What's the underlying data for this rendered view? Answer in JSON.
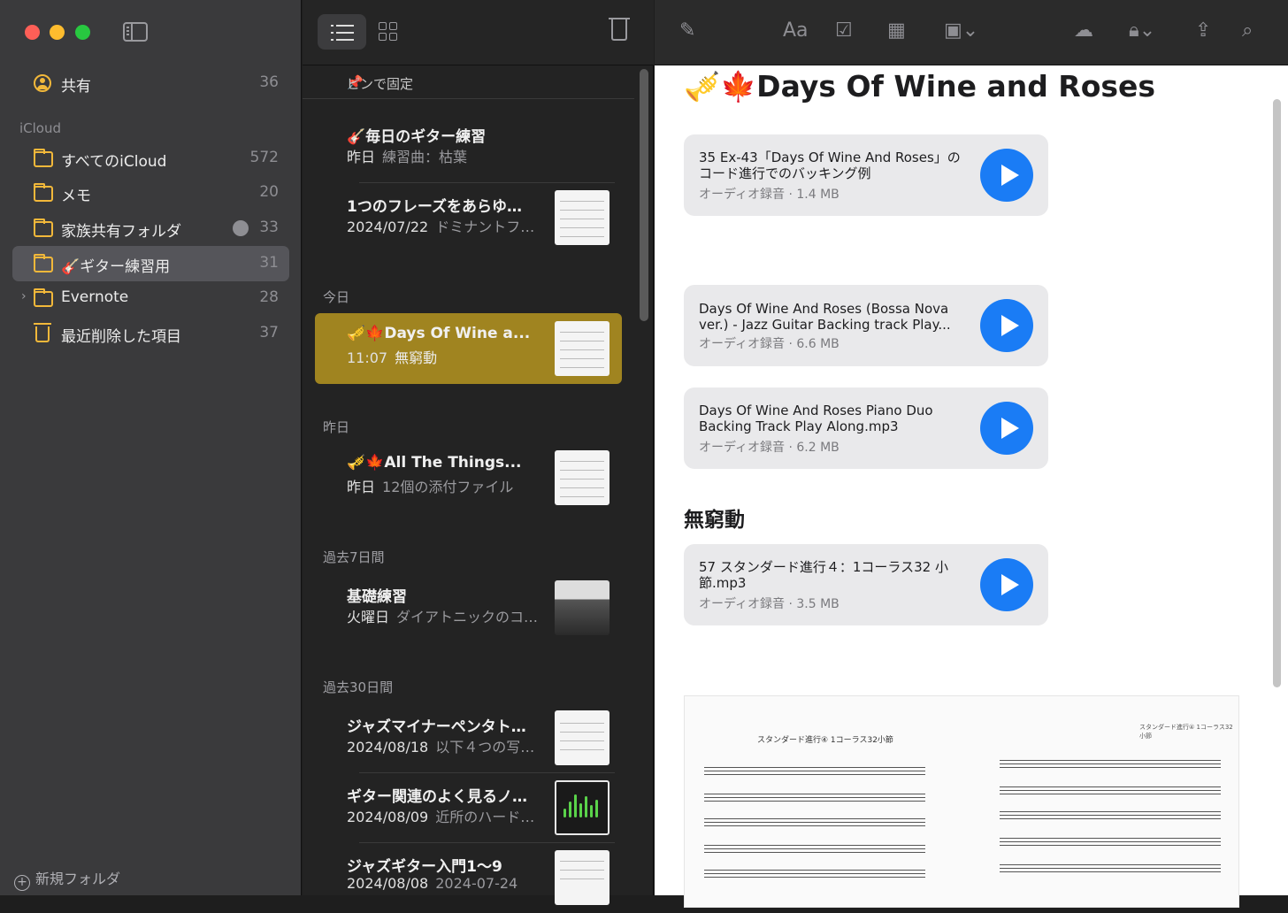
{
  "colors": {
    "accent": "#f2b83a",
    "selected_note": "#a08420",
    "play_button": "#1a7cf5",
    "red": "#fe5f57",
    "yellow": "#febc2e",
    "green": "#28c840"
  },
  "sidebar": {
    "shared": {
      "label": "共有",
      "count": "36"
    },
    "section": "iCloud",
    "folders": [
      {
        "label": "すべてのiCloud",
        "count": "572",
        "icon": "folder-icon"
      },
      {
        "label": "メモ",
        "count": "20",
        "icon": "folder-icon"
      },
      {
        "label": "家族共有フォルダ",
        "count": "33",
        "icon": "shared-folder-icon"
      },
      {
        "label": "🎸ギター練習用",
        "count": "31",
        "icon": "folder-icon"
      },
      {
        "label": "Evernote",
        "count": "28",
        "icon": "folder-icon"
      },
      {
        "label": "最近削除した項目",
        "count": "37",
        "icon": "trash-icon"
      }
    ],
    "new_folder": "新規フォルダ"
  },
  "list": {
    "pinned_header": "ピンで固定",
    "sections": {
      "today": "今日",
      "yesterday": "昨日",
      "last7": "過去7日間",
      "last30": "過去30日間"
    },
    "notes": [
      {
        "title": "🎸毎日のギター練習",
        "date": "昨日",
        "preview": "練習曲：枯葉"
      },
      {
        "title": "1つのフレーズをあらゆ…",
        "date": "2024/07/22",
        "preview": "ドミナントフ…"
      },
      {
        "title": "🎺🍁Days Of Wine a...",
        "date": "11:07",
        "preview": "無窮動"
      },
      {
        "title": "🎺🍁All The Things...",
        "date": "昨日",
        "preview": "12個の添付ファイル"
      },
      {
        "title": "基礎練習",
        "date": "火曜日",
        "preview": "ダイアトニックのコ…"
      },
      {
        "title": "ジャズマイナーペンタト…",
        "date": "2024/08/18",
        "preview": "以下４つの写…"
      },
      {
        "title": "ギター関連のよく見るノ…",
        "date": "2024/08/09",
        "preview": "近所のハード…"
      },
      {
        "title": "ジャズギター入門1〜9",
        "date": "2024/08/08",
        "preview": "2024-07-24"
      }
    ]
  },
  "editor": {
    "toolbar": {
      "format": "Aa"
    },
    "title": "🎺🍁Days Of Wine and Roses",
    "attachments": [
      {
        "name": "35 Ex-43「Days Of Wine And Roses」のコード進行でのバッキング例",
        "meta": "オーディオ録音 · 1.4 MB"
      },
      {
        "name": "Days Of Wine And Roses (Bossa Nova ver.) - Jazz Guitar Backing track  Play...",
        "meta": "オーディオ録音 · 6.6 MB"
      },
      {
        "name": "Days Of Wine And Roses Piano Duo Backing Track  Play Along.mp3",
        "meta": "オーディオ録音 · 6.2 MB"
      },
      {
        "name": "57 スタンダード進行４：1コーラス32 小節.mp3",
        "meta": "オーディオ録音 · 3.5 MB"
      }
    ],
    "heading": "無窮動",
    "sheet_title": "スタンダード進行④ 1コーラス32小節",
    "sheet_title_right": "スタンダード進行④ 1コーラス32小節"
  }
}
